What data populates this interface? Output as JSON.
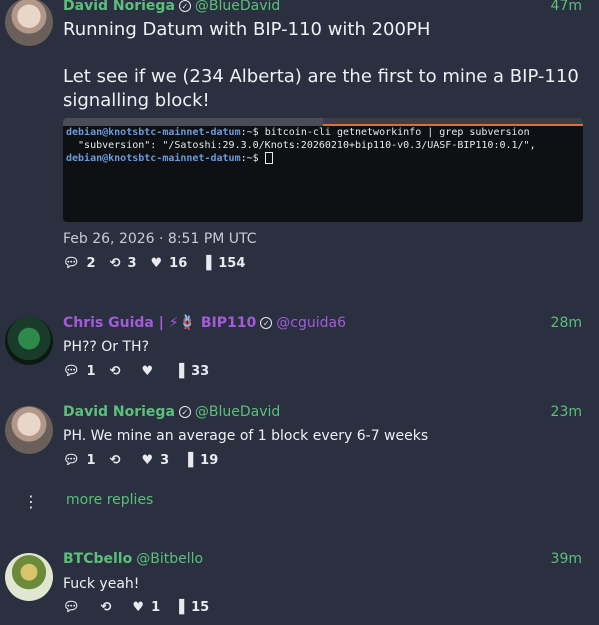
{
  "thread": [
    {
      "author": "David Noriega",
      "handle": "@BlueDavid",
      "time": "47m",
      "line1": "Running Datum with BIP-110 with 200PH",
      "line2": "Let see if we (234 Alberta) are the first to mine a BIP-110",
      "line3": "signalling block!",
      "date": "Feb 26, 2026 · 8:51 PM UTC",
      "replies": "2",
      "reposts": "3",
      "likes": "16",
      "views": "154",
      "terminal": {
        "prompt": "debian@knotsbtc-mainnet-datum",
        "cmd1": ":~$ bitcoin-cli getnetworkinfo | grep subversion",
        "out1": "  \"subversion\": \"/Satoshi:29.3.0/Knots:20260210+bip110-v0.3/UASF-BIP110:0.1/\",",
        "cmd2": ":~$ "
      }
    },
    {
      "author": "Chris Guida | ⚡🪢 BIP110",
      "handle": "@cguida6",
      "time": "28m",
      "text": "PH?? Or TH?",
      "replies": "1",
      "reposts": "",
      "likes": "",
      "views": "33"
    },
    {
      "author": "David Noriega",
      "handle": "@BlueDavid",
      "time": "23m",
      "text": "PH. We mine an average of 1 block every 6-7 weeks",
      "replies": "1",
      "reposts": "",
      "likes": "3",
      "views": "19"
    },
    {
      "author": "BTCbello",
      "handle": "@Bitbello",
      "time": "39m",
      "text": "Fuck yeah!",
      "replies": "",
      "reposts": "",
      "likes": "1",
      "views": "15"
    }
  ],
  "more_replies": "more replies",
  "icons": {
    "reply": "speech-bubble",
    "repost": "repeat-arrows",
    "like": "heart",
    "views": "bar-chart",
    "verified": "check-badge",
    "more": "vertical-dots"
  }
}
